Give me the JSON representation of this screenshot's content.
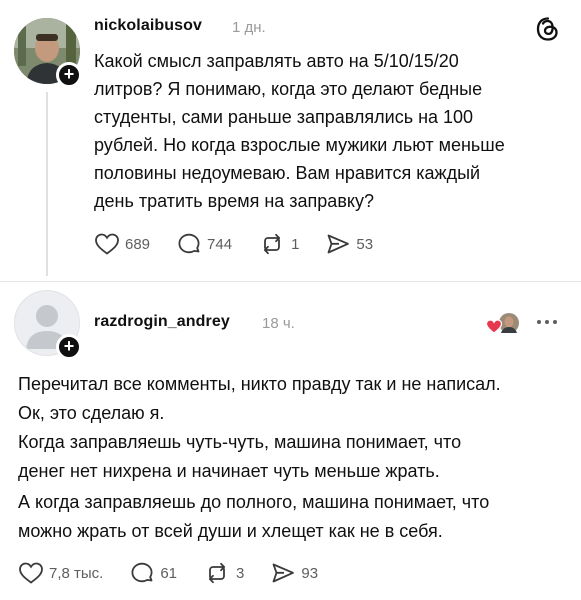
{
  "post": {
    "username": "nickolaibusov",
    "time": "1 дн.",
    "text_lines": [
      "Какой смысл заправлять авто на 5/10/15/20",
      "литров? Я понимаю, когда это делают бедные",
      "студенты, сами раньше заправлялись на 100",
      "рублей. Но когда взрослые мужики льют меньше",
      "половины недоумеваю. Вам нравится каждый",
      "день тратить время на заправку?"
    ],
    "likes": "689",
    "replies": "744",
    "reposts": "1",
    "shares": "53"
  },
  "reply": {
    "username": "razdrogin_andrey",
    "time": "18 ч.",
    "paragraphs": [
      [
        "Перечитал все комменты, никто правду так и не написал.",
        "Ок, это сделаю я."
      ],
      [
        "Когда заправляешь чуть-чуть, машина понимает, что",
        "денег нет нихрена и начинает чуть меньше жрать."
      ],
      [
        "А когда заправляешь до полного, машина понимает, что",
        "можно жрать от всей души и хлещет как не в себя."
      ]
    ],
    "likes": "7,8 тыс.",
    "replies": "61",
    "reposts": "3",
    "shares": "93"
  },
  "icons": {
    "logo": "threads-logo-icon",
    "heart": "heart-icon",
    "comment": "comment-bubble-icon",
    "repost": "repost-icon",
    "share": "share-icon",
    "more": "more-icon",
    "plus": "plus-icon"
  },
  "colors": {
    "text": "#101010",
    "muted": "#9a9a9a",
    "heart_red": "#e8384f"
  }
}
